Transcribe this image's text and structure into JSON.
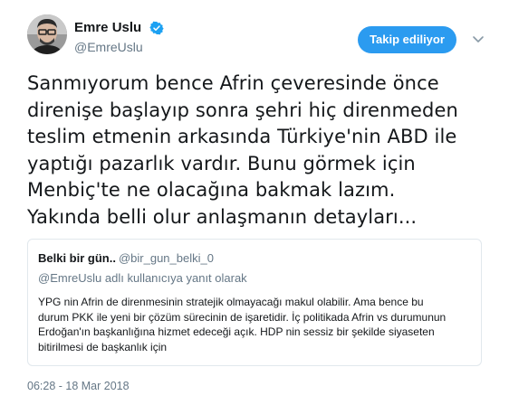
{
  "author": {
    "display_name": "Emre Uslu",
    "handle": "@EmreUslu",
    "verified_icon": "verified-badge-icon",
    "avatar_icon": "profile-photo"
  },
  "follow_button": {
    "label": "Takip ediliyor",
    "color": "#2b9bf0"
  },
  "menu_icon": "chevron-down-icon",
  "tweet": {
    "lines": [
      "Sanmıyorum bence Afrin çeveresinde önce",
      "direnişe başlayıp sonra şehri hiç direnmeden",
      "teslim etmenin arkasında Türkiye'nin ABD ile",
      "yaptığı pazarlık vardır.  Bunu görmek için",
      "Menbiç'te ne olacağına bakmak lazım.",
      "Yakında belli olur anlaşmanın detayları..."
    ]
  },
  "quoted_tweet": {
    "display_name": "Belki bir gün..",
    "handle": "@bir_gun_belki_0",
    "reply_context": "@EmreUslu adlı kullanıcıya yanıt olarak",
    "lines": [
      "YPG nin Afrin de direnmesinin stratejik  olmayacağı makul olabilir. Ama bence bu",
      "durum PKK ile yeni bir çözüm sürecinin de işaretidir. İç politikada Afrin vs durumunun",
      "Erdoğan'ın başkanlığına hizmet edeceği açık. HDP nin sessiz bir  şekilde siyaseten",
      "bitirilmesi de başkanlık için"
    ]
  },
  "timestamp": "06:28 - 18 Mar 2018",
  "colors": {
    "text": "#14171a",
    "secondary": "#657786",
    "border": "#e1e8ed",
    "accent": "#1da1f2"
  }
}
